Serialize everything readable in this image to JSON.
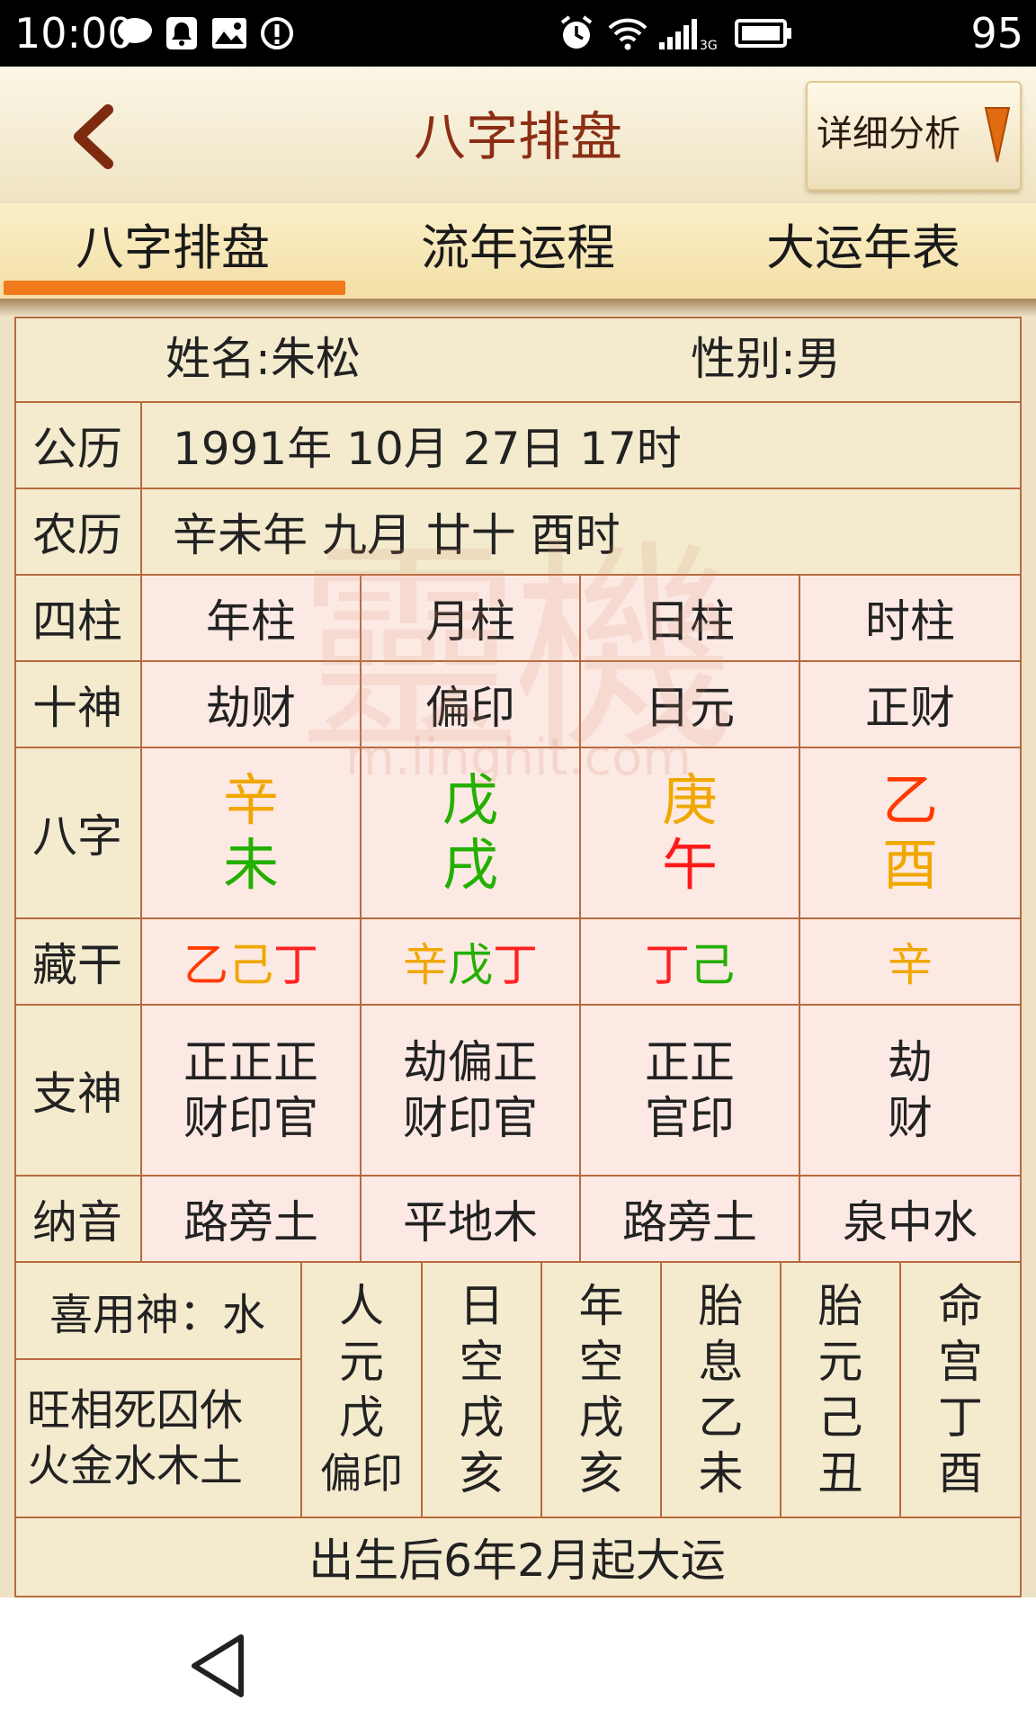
{
  "status_bar": {
    "time": "10:00",
    "battery": "95"
  },
  "header": {
    "title": "八字排盘",
    "analysis_button": "详细分析"
  },
  "tabs": [
    "八字排盘",
    "流年运程",
    "大运年表"
  ],
  "person": {
    "name": "姓名:朱松",
    "gender": "性别:男"
  },
  "dates": {
    "solar_label": "公历",
    "solar_value": "1991年 10月 27日 17时",
    "lunar_label": "农历",
    "lunar_value": "辛未年 九月 廿十 酉时"
  },
  "labels": {
    "pillars": "四柱",
    "ten_gods": "十神",
    "bazi": "八字",
    "hidden_stems": "藏干",
    "branch_gods": "支神",
    "nayin": "纳音"
  },
  "pillars": [
    {
      "name": "年柱",
      "ten_god": "劫财",
      "stem": "辛",
      "stem_color": "#f0a800",
      "branch": "未",
      "branch_color": "#23b000",
      "hidden": [
        {
          "c": "乙",
          "color": "#ff3a00"
        },
        {
          "c": "己",
          "color": "#f0a800"
        },
        {
          "c": "丁",
          "color": "#ff2222"
        }
      ],
      "branch_god": [
        "正正正",
        "财印官"
      ],
      "nayin": "路旁土"
    },
    {
      "name": "月柱",
      "ten_god": "偏印",
      "stem": "戊",
      "stem_color": "#23b000",
      "branch": "戌",
      "branch_color": "#23b000",
      "hidden": [
        {
          "c": "辛",
          "color": "#f0a800"
        },
        {
          "c": "戊",
          "color": "#23b000"
        },
        {
          "c": "丁",
          "color": "#ff2222"
        }
      ],
      "branch_god": [
        "劫偏正",
        "财印官"
      ],
      "nayin": "平地木"
    },
    {
      "name": "日柱",
      "ten_god": "日元",
      "stem": "庚",
      "stem_color": "#f0a800",
      "branch": "午",
      "branch_color": "#ff1a1a",
      "hidden": [
        {
          "c": "丁",
          "color": "#ff2222"
        },
        {
          "c": "己",
          "color": "#23b000"
        }
      ],
      "branch_god": [
        "正正",
        "官印"
      ],
      "nayin": "路旁土"
    },
    {
      "name": "时柱",
      "ten_god": "正财",
      "stem": "乙",
      "stem_color": "#ff3a00",
      "branch": "酉",
      "branch_color": "#f0a800",
      "hidden": [
        {
          "c": "辛",
          "color": "#f0a800"
        }
      ],
      "branch_god": [
        "劫",
        "财"
      ],
      "nayin": "泉中水"
    }
  ],
  "favorable": {
    "label": "喜用神：水",
    "line1": "旺相死囚休",
    "line2": "火金水木土"
  },
  "extra_columns": [
    {
      "title": "人元",
      "v1": "戊",
      "v2": "偏印"
    },
    {
      "title": "日空",
      "v1": "戌",
      "v2": "亥"
    },
    {
      "title": "年空",
      "v1": "戌",
      "v2": "亥"
    },
    {
      "title": "胎息",
      "v1": "乙",
      "v2": "未"
    },
    {
      "title": "胎元",
      "v1": "己",
      "v2": "丑"
    },
    {
      "title": "命宫",
      "v1": "丁",
      "v2": "酉"
    }
  ],
  "footer": "出生后6年2月起大运",
  "watermark": {
    "text": "靈機",
    "url": "m.linghit.com"
  }
}
